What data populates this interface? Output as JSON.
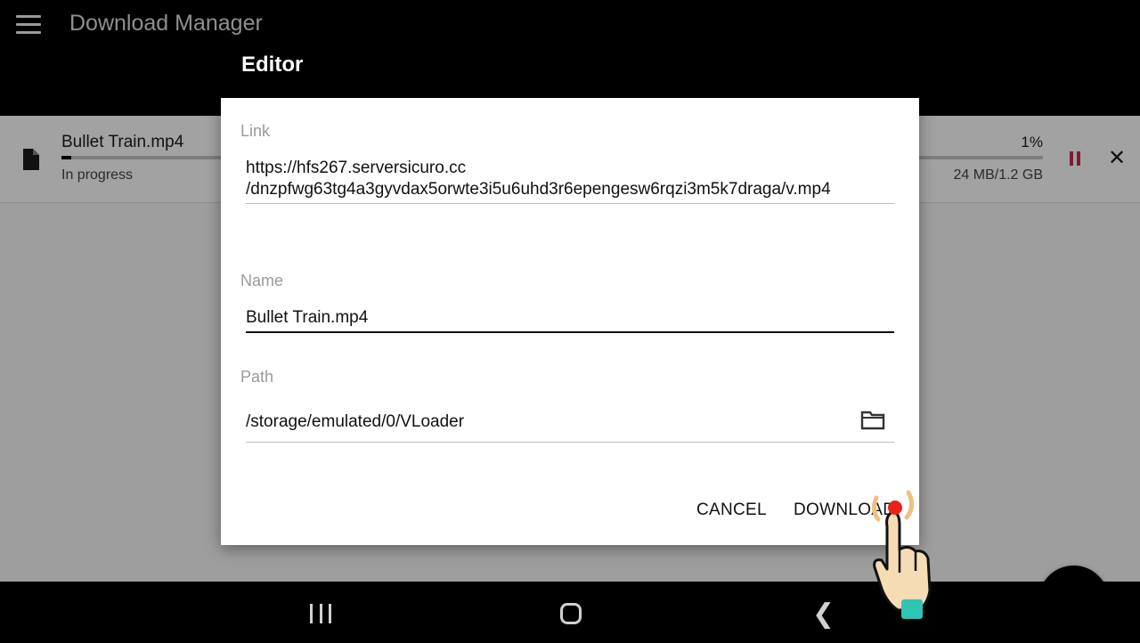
{
  "app": {
    "title": "Download Manager",
    "menu_icon": "hamburger-menu-icon"
  },
  "download_item": {
    "name": "Bullet Train.mp4",
    "status": "In progress",
    "percent_text": "1%",
    "progress": 0.01,
    "size": "24 MB/1.2 GB",
    "icon": "file-icon"
  },
  "dialog": {
    "title": "Editor",
    "link_label": "Link",
    "link_line1": "https://hfs267.serversicuro.cc",
    "link_line2": "/dnzpfwg63tg4a3gyvdax5orwte3i5u6uhd3r6epengesw6rqzi3m5k7draga/v.mp4",
    "name_label": "Name",
    "name_value": "Bullet Train.mp4",
    "path_label": "Path",
    "path_value": "/storage/emulated/0/VLoader",
    "cancel_label": "CANCEL",
    "download_label": "DOWNLOAD"
  },
  "fab": {
    "label": "+"
  },
  "navbar": {
    "recents_icon": "recents-icon",
    "home_icon": "home-icon",
    "back_icon": "back-icon"
  },
  "colors": {
    "scrim_bg": "#9e9e9e",
    "dialog_bg": "#ffffff",
    "pause_accent": "#7a1f33",
    "tap_indicator": "#e8231a"
  }
}
